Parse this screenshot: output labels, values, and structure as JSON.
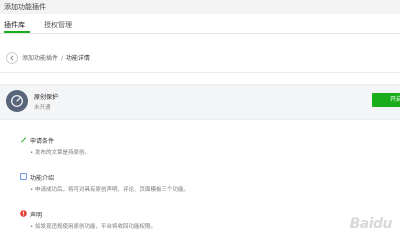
{
  "app": {
    "title": "添加功能插件"
  },
  "tabs": [
    {
      "label": "插件库"
    },
    {
      "label": "授权管理"
    }
  ],
  "breadcrumb": {
    "parent": "添加功能插件",
    "separator": "/",
    "current": "功能详情"
  },
  "plugin": {
    "name": "原创保护",
    "status": "未开通",
    "open_label": "开启"
  },
  "sections": [
    {
      "title": "申请条件",
      "desc": "• 发布的文章是持原创。"
    },
    {
      "title": "功能介绍",
      "desc": "• 申请成功后，将可对具有原创声明、评论、页面模板三个功能。"
    },
    {
      "title": "声明",
      "desc": "• 如发现违规使用原创功能，平台将收回功能权限。"
    }
  ],
  "colors": {
    "accent": "#1aad19",
    "card_bg": "#f4f5f7",
    "icon_bg": "#57647a",
    "warn": "#e64340",
    "info": "#5b8de0"
  },
  "watermark": "Baidu"
}
